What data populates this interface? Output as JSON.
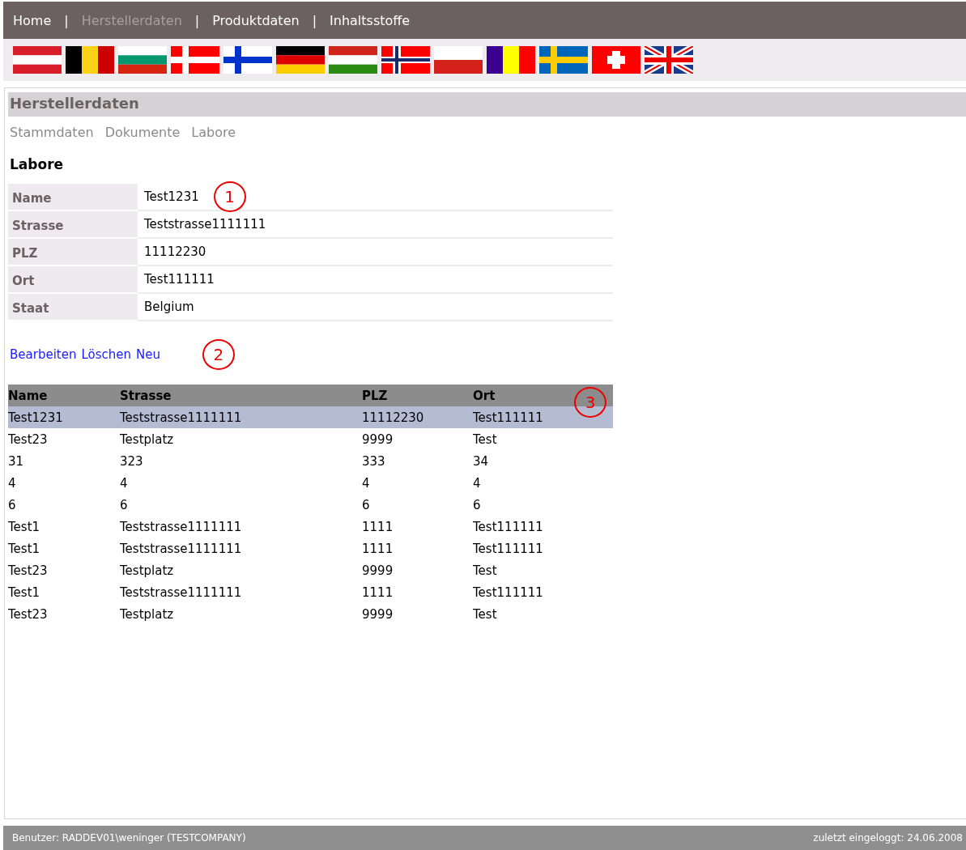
{
  "nav": {
    "items": [
      {
        "label": "Home",
        "selected": false
      },
      {
        "label": "Herstellerdaten",
        "selected": true
      },
      {
        "label": "Produktdaten",
        "selected": false
      },
      {
        "label": "Inhaltsstoffe",
        "selected": false
      }
    ],
    "separators": [
      "|",
      "|",
      "|"
    ]
  },
  "section_title": "Herstellerdaten",
  "subnav": [
    "Stammdaten",
    "Dokumente",
    "Labore"
  ],
  "heading": "Labore",
  "details": [
    {
      "label": "Name",
      "value": "Test1231"
    },
    {
      "label": "Strasse",
      "value": "Teststrasse1111111"
    },
    {
      "label": "PLZ",
      "value": "11112230"
    },
    {
      "label": "Ort",
      "value": "Test111111"
    },
    {
      "label": "Staat",
      "value": "Belgium"
    }
  ],
  "markers": [
    "1",
    "2",
    "3"
  ],
  "actions": [
    "Bearbeiten",
    "Löschen",
    "Neu"
  ],
  "table": {
    "columns": [
      "Name",
      "Strasse",
      "PLZ",
      "Ort"
    ],
    "rows": [
      {
        "cells": [
          "Test1231",
          "Teststrasse1111111",
          "11112230",
          "Test111111"
        ],
        "selected": true
      },
      {
        "cells": [
          "Test23",
          "Testplatz",
          "9999",
          "Test"
        ],
        "selected": false
      },
      {
        "cells": [
          "31",
          "323",
          "333",
          "34"
        ],
        "selected": false
      },
      {
        "cells": [
          "4",
          "4",
          "4",
          "4"
        ],
        "selected": false
      },
      {
        "cells": [
          "6",
          "6",
          "6",
          "6"
        ],
        "selected": false
      },
      {
        "cells": [
          "Test1",
          "Teststrasse1111111",
          "1111",
          "Test111111"
        ],
        "selected": false
      },
      {
        "cells": [
          "Test1",
          "Teststrasse1111111",
          "1111",
          "Test111111"
        ],
        "selected": false
      },
      {
        "cells": [
          "Test23",
          "Testplatz",
          "9999",
          "Test"
        ],
        "selected": false
      },
      {
        "cells": [
          "Test1",
          "Teststrasse1111111",
          "1111",
          "Test111111"
        ],
        "selected": false
      },
      {
        "cells": [
          "Test23",
          "Testplatz",
          "9999",
          "Test"
        ],
        "selected": false
      }
    ]
  },
  "status_bar": {
    "user": "Benutzer: RADDEV01\\weninger (TESTCOMPANY)",
    "last_login": "zuletzt eingeloggt: 24.06.2008"
  }
}
